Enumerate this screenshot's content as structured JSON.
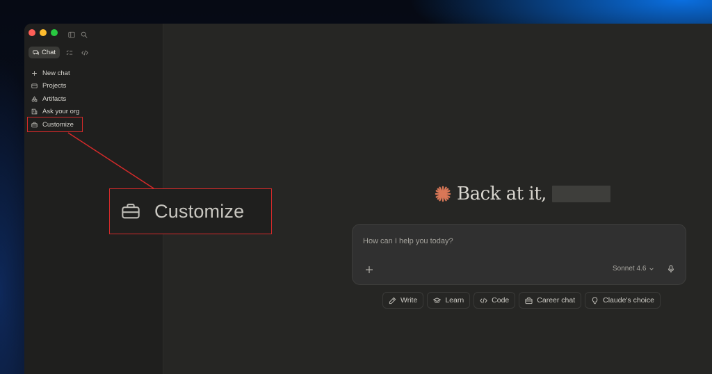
{
  "sidebar": {
    "mode_tabs": {
      "chat_label": "Chat"
    },
    "items": [
      {
        "label": "New chat",
        "icon": "plus-icon"
      },
      {
        "label": "Projects",
        "icon": "folder-icon"
      },
      {
        "label": "Artifacts",
        "icon": "shapes-icon"
      },
      {
        "label": "Ask your org",
        "icon": "building-icon"
      },
      {
        "label": "Customize",
        "icon": "briefcase-icon"
      }
    ]
  },
  "callout": {
    "label": "Customize",
    "icon": "briefcase-icon",
    "color": "#d42a2a"
  },
  "greeting": {
    "text": "Back at it,",
    "icon": "claude-spark-icon",
    "accent": "#d97757"
  },
  "composer": {
    "placeholder": "How can I help you today?",
    "model": "Sonnet 4.6"
  },
  "chips": [
    {
      "label": "Write",
      "icon": "pencil-icon"
    },
    {
      "label": "Learn",
      "icon": "graduation-cap-icon"
    },
    {
      "label": "Code",
      "icon": "code-icon"
    },
    {
      "label": "Career chat",
      "icon": "briefcase-icon"
    },
    {
      "label": "Claude's choice",
      "icon": "lightbulb-icon"
    }
  ]
}
